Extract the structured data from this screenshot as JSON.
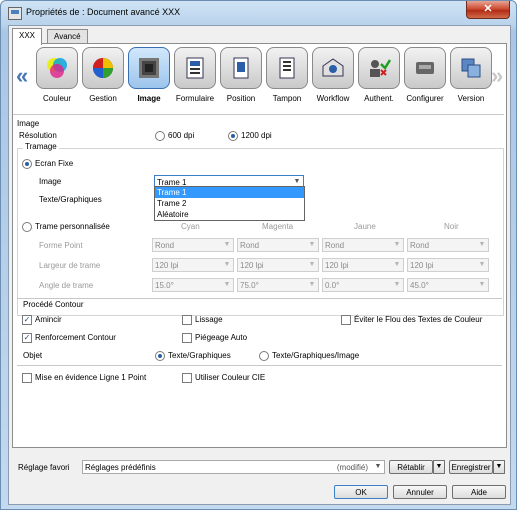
{
  "window": {
    "title": "Propriétés de : Document avancé XXX",
    "close_label": "✕"
  },
  "tabs": [
    {
      "label": "XXX"
    },
    {
      "label": "Avancé"
    }
  ],
  "iconbar": {
    "items": [
      {
        "label": "Couleur",
        "icon": "color-icon"
      },
      {
        "label": "Gestion",
        "icon": "color-management-icon"
      },
      {
        "label": "Image",
        "icon": "image-icon"
      },
      {
        "label": "Formulaire",
        "icon": "form-icon"
      },
      {
        "label": "Position",
        "icon": "position-icon"
      },
      {
        "label": "Tampon",
        "icon": "stamp-icon"
      },
      {
        "label": "Workflow",
        "icon": "workflow-icon"
      },
      {
        "label": "Authent.",
        "icon": "authentication-icon"
      },
      {
        "label": "Configurer",
        "icon": "configure-icon"
      },
      {
        "label": "Version",
        "icon": "version-icon"
      }
    ],
    "selected": "Image"
  },
  "image": {
    "section_label": "Image",
    "resolution_label": "Résolution",
    "res_600": "600 dpi",
    "res_1200": "1200 dpi",
    "tramage_label": "Tramage",
    "ecran_fixe_label": "Ecran Fixe",
    "image_field_label": "Image",
    "image_value": "Trame 1",
    "texte_graphiques_label": "Texte/Graphiques",
    "dropdown_options": [
      "Trame 1",
      "Trame 2",
      "Aléatoire"
    ],
    "trame_perso_label": "Trame personnalisée",
    "columns": [
      "Cyan",
      "Magenta",
      "Jaune",
      "Noir"
    ],
    "rows": [
      {
        "label": "Forme Point",
        "values": [
          "Rond",
          "Rond",
          "Rond",
          "Rond"
        ]
      },
      {
        "label": "Largeur de trame",
        "values": [
          "120 lpi",
          "120 lpi",
          "120 lpi",
          "120 lpi"
        ]
      },
      {
        "label": "Angle de trame",
        "values": [
          "15.0°",
          "75.0°",
          "0.0°",
          "45.0°"
        ]
      }
    ]
  },
  "contour": {
    "section_label": "Procédé Contour",
    "amincir": "Amincir",
    "lissage": "Lissage",
    "eviter_flou": "Éviter le Flou des Textes de Couleur",
    "renforcement": "Renforcement Contour",
    "piegeage": "Piégeage Auto",
    "objet_label": "Objet",
    "objet_texte": "Texte/Graphiques",
    "objet_texte_image": "Texte/Graphiques/Image"
  },
  "misc": {
    "mise_en_evidence": "Mise en évidence Ligne 1 Point",
    "couleur_cie": "Utiliser Couleur CIE"
  },
  "footer": {
    "favorite_label": "Réglage favori",
    "favorite_value": "Réglages prédéfinis",
    "modified": "(modifié)",
    "retablir": "Rétablir",
    "enregistrer": "Enregistrer",
    "ok": "OK",
    "annuler": "Annuler",
    "aide": "Aide"
  }
}
